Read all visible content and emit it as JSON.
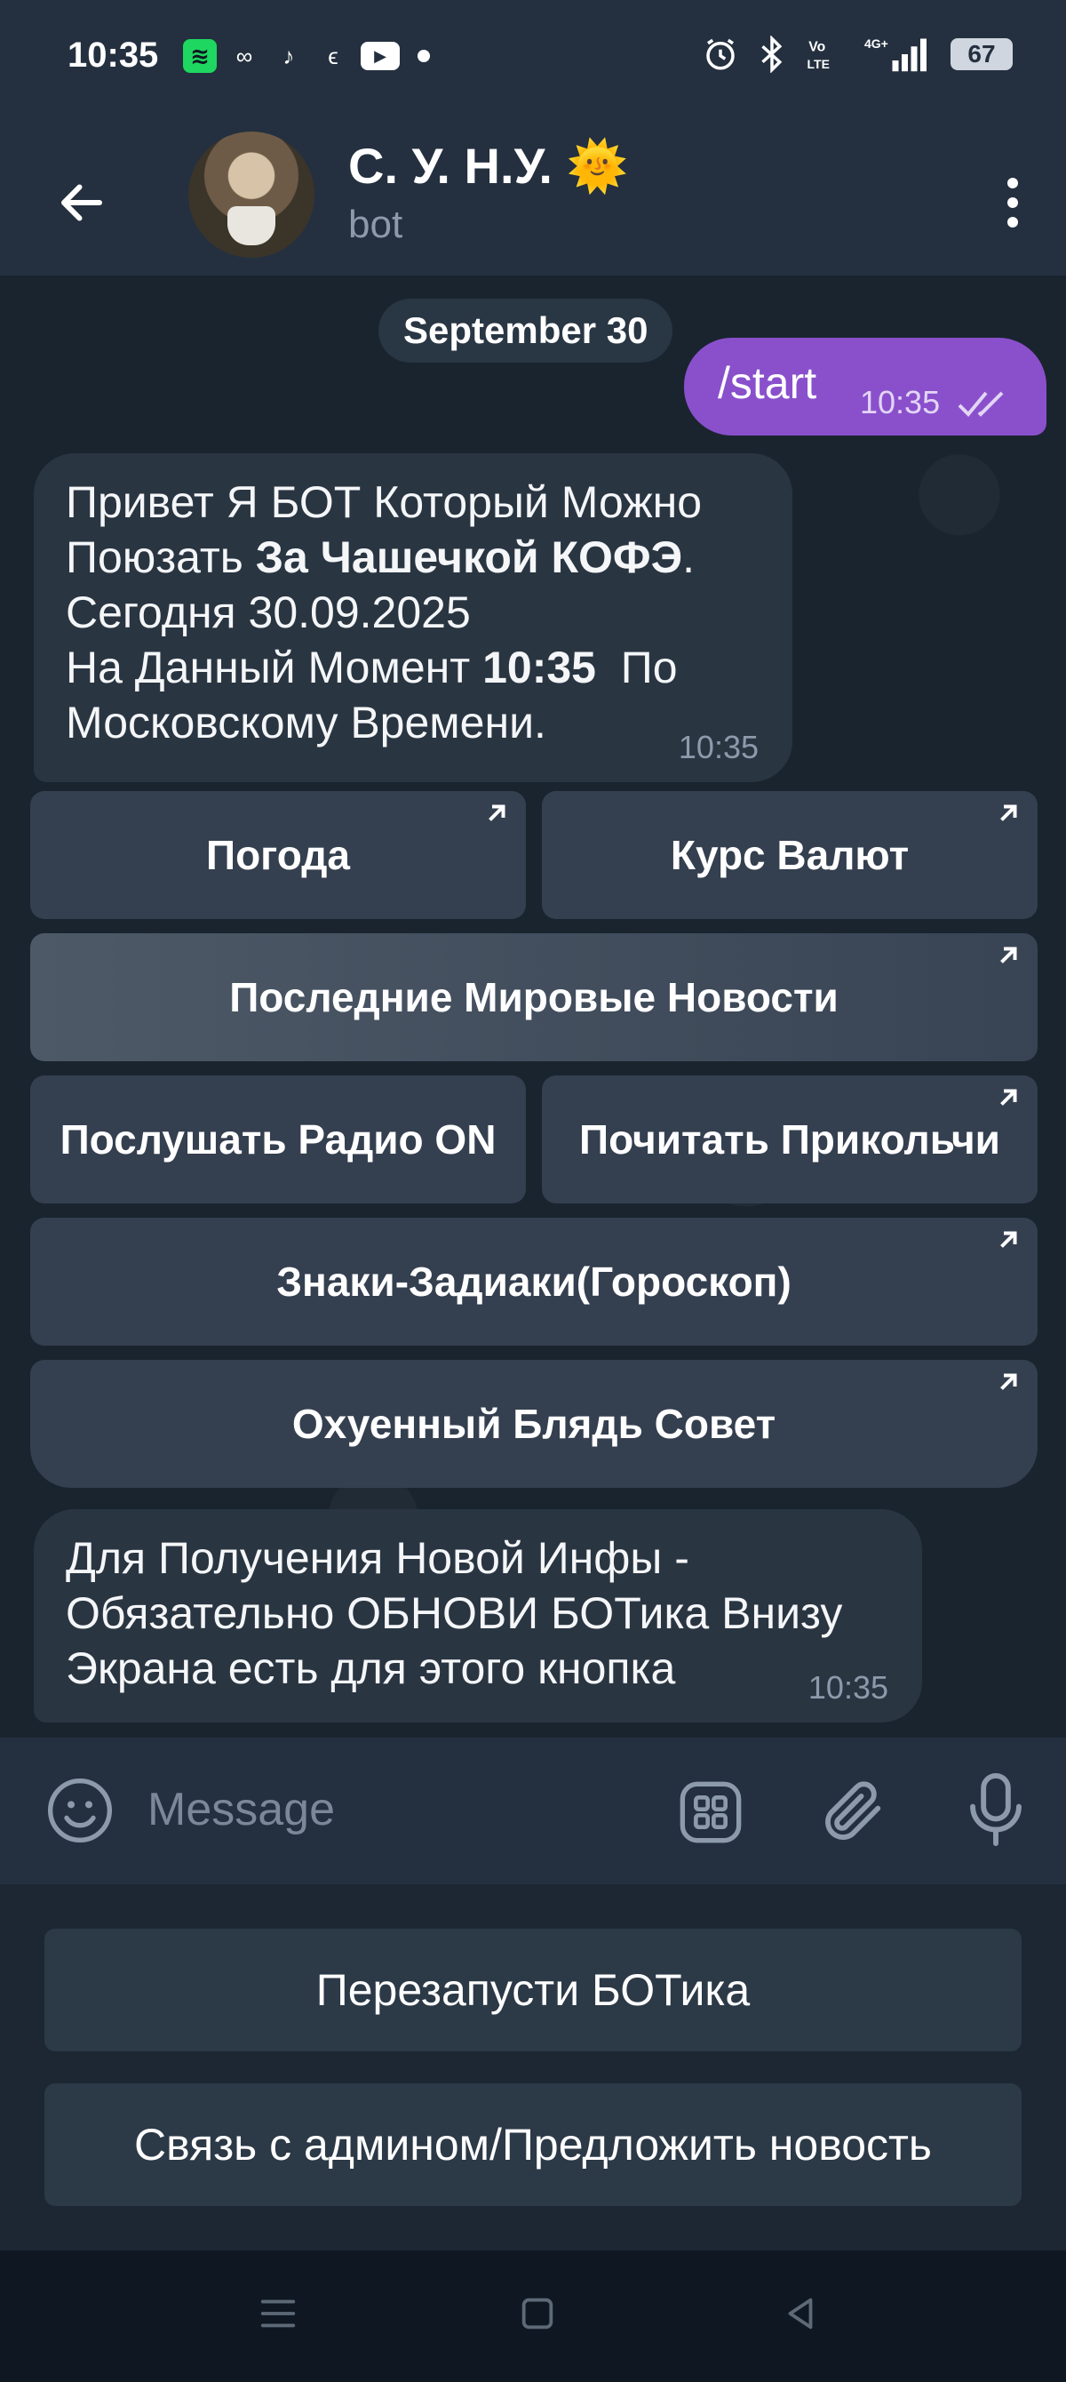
{
  "status_bar": {
    "time": "10:35",
    "battery": "67",
    "network": "4G+"
  },
  "header": {
    "title": "С. У. Н.У. 🌞",
    "subtitle": "bot"
  },
  "chat": {
    "date_label": "September 30",
    "outgoing": {
      "text": "/start",
      "time": "10:35"
    },
    "bot_message_1": {
      "line1": "Привет Я БОТ Который Можно",
      "line2_plain": "Поюзать ",
      "line2_bold": "За Чашечкой КОФЭ",
      "line2_end": ".",
      "line3": "Сегодня 30.09.2025",
      "line4_plain": "На Данный Момент ",
      "line4_bold": "10:35",
      "line4_end": "  По",
      "line5": "Московскому Времени.",
      "time": "10:35"
    },
    "inline_buttons": [
      "Погода",
      "Курс Валют",
      "Последние Мировые Новости",
      "Послушать Радио ON",
      "Почитать Прикольчи",
      "Знаки-Задиаки(Гороскоп)",
      "Охуенный Блядь Совет"
    ],
    "bot_message_2": {
      "line1": "Для Получения Новой Инфы -",
      "line2": "Обязательно ОБНОВИ БОТика Внизу",
      "line3": "Экрана есть для этого кнопка",
      "time": "10:35"
    }
  },
  "input": {
    "placeholder": "Message"
  },
  "reply_keyboard": [
    "Перезапусти БОТика",
    "Связь с админом/Предложить новость"
  ],
  "colors": {
    "header_bg": "#24303f",
    "outgoing_bubble": "#8a50cc",
    "incoming_bubble": "#2a3542",
    "button_bg": "#364252"
  },
  "icons": {
    "back": "arrow-left-icon",
    "menu": "more-vertical-icon",
    "emoji": "smile-icon",
    "bot_commands": "grid-icon",
    "attach": "paperclip-icon",
    "mic": "microphone-icon"
  }
}
